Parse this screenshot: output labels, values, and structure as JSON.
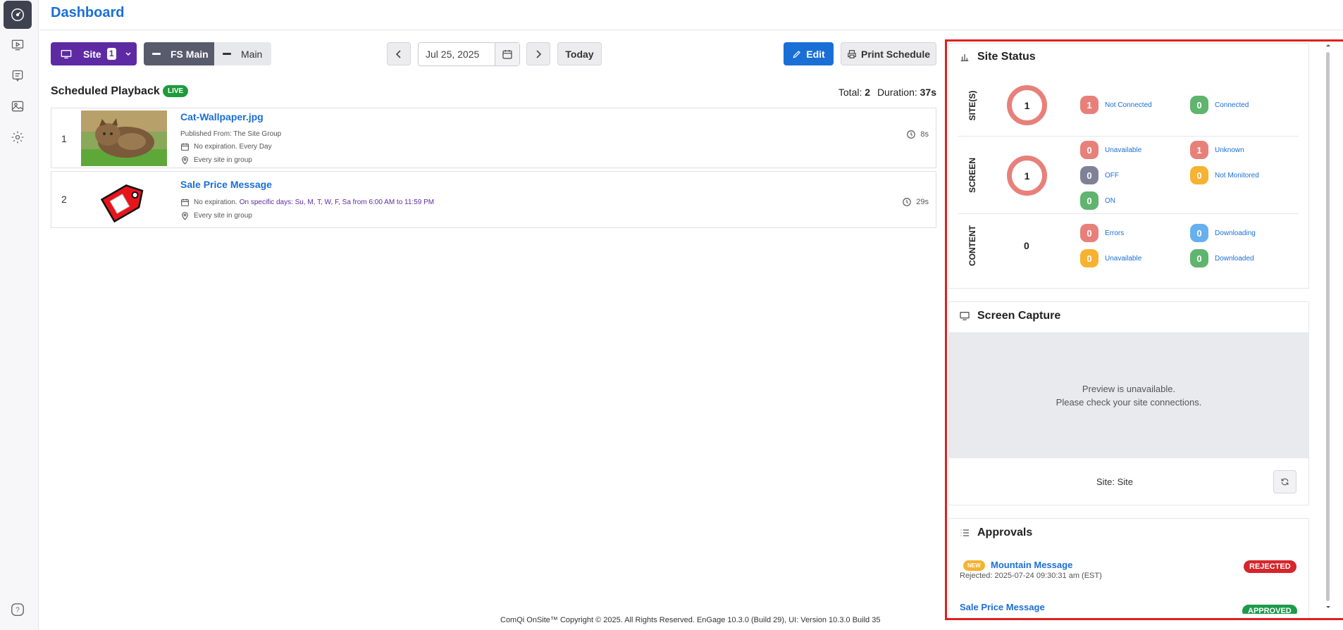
{
  "header": {
    "title": "Dashboard"
  },
  "toolbar": {
    "site_label": "Site",
    "site_count": "1",
    "fs_main_label": "FS Main",
    "main_label": "Main",
    "date_value": "Jul 25, 2025",
    "today_label": "Today",
    "edit_label": "Edit",
    "print_label": "Print Schedule"
  },
  "schedule": {
    "heading": "Scheduled Playback",
    "live_badge": "LIVE",
    "total_label": "Total:",
    "total_value": "2",
    "duration_label": "Duration:",
    "duration_value": "37s",
    "items": [
      {
        "index": "1",
        "title": "Cat-Wallpaper.jpg",
        "published": "Published From: The Site Group",
        "expiration": "No expiration. Every Day",
        "expiration_detail": "",
        "location": "Every site in group",
        "duration": "8s"
      },
      {
        "index": "2",
        "title": "Sale Price Message",
        "expiration": "No expiration.",
        "expiration_detail": "On specific days: Su, M, T, W, F, Sa from 6:00 AM to 11:59 PM",
        "location": "Every site in group",
        "duration": "29s"
      }
    ]
  },
  "site_status": {
    "title": "Site Status",
    "sites_label": "SITE(S)",
    "sites_total": "1",
    "sites_not_connected": {
      "count": "1",
      "label": "Not Connected"
    },
    "sites_connected": {
      "count": "0",
      "label": "Connected"
    },
    "screen_label": "SCREEN",
    "screen_total": "1",
    "screen_unavailable": {
      "count": "0",
      "label": "Unavailable"
    },
    "screen_unknown": {
      "count": "1",
      "label": "Unknown"
    },
    "screen_off": {
      "count": "0",
      "label": "OFF"
    },
    "screen_not_monitored": {
      "count": "0",
      "label": "Not Monitored"
    },
    "screen_on": {
      "count": "0",
      "label": "ON"
    },
    "content_label": "CONTENT",
    "content_total": "0",
    "content_errors": {
      "count": "0",
      "label": "Errors"
    },
    "content_downloading": {
      "count": "0",
      "label": "Downloading"
    },
    "content_unavailable": {
      "count": "0",
      "label": "Unavailable"
    },
    "content_downloaded": {
      "count": "0",
      "label": "Downloaded"
    }
  },
  "screen_capture": {
    "title": "Screen Capture",
    "preview_line1": "Preview is unavailable.",
    "preview_line2": "Please check your site connections.",
    "site_label": "Site: Site"
  },
  "approvals": {
    "title": "Approvals",
    "items": [
      {
        "new_badge": "NEW",
        "title": "Mountain Message",
        "detail": "Rejected: 2025-07-24 09:30:31 am (EST)",
        "status": "REJECTED",
        "status_color": "#d4262b"
      },
      {
        "title": "Sale Price Message",
        "status": "APPROVED",
        "status_color": "#1e9a4c"
      }
    ]
  },
  "footer": {
    "text": "ComQi OnSite™ Copyright © 2025. All Rights Reserved. EnGage 10.3.0 (Build 29), UI: Version 10.3.0 Build 35"
  },
  "colors": {
    "accent": "#1a6fd6",
    "site_button": "#5e2aa3",
    "live": "#1e9a3c",
    "highlight_border": "#e02020"
  }
}
